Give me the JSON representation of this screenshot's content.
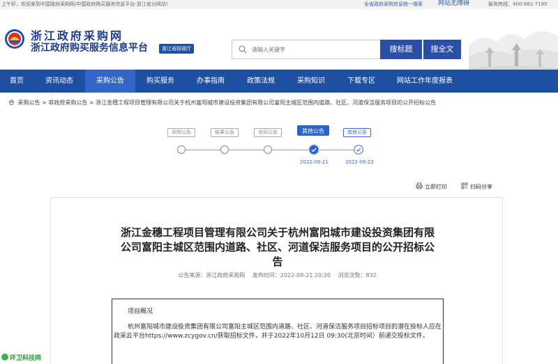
{
  "topbar": {
    "welcome": "上午好，欢迎来到中国政府采购网/中国政府购买服务信息平台-浙江省分网站！",
    "link_service": "全省政府采购信息统一搜索",
    "barrier_free": "网站无障碍",
    "phone": "服务热线：400-881-7190"
  },
  "header": {
    "brand_line1": "浙江政府采购网",
    "brand_line2": "浙江政府购买服务信息平台",
    "dept": "浙江省财政厅",
    "search_placeholder": "请输入关键字",
    "search_title_btn": "搜标题",
    "search_full_btn": "搜全文"
  },
  "nav": {
    "items": [
      {
        "label": "首页"
      },
      {
        "label": "资讯动态"
      },
      {
        "label": "采购公告"
      },
      {
        "label": "购买服务"
      },
      {
        "label": "办事指南"
      },
      {
        "label": "政策法规"
      },
      {
        "label": "采购知识"
      },
      {
        "label": "下载专区"
      },
      {
        "label": "网站工作年度报表"
      }
    ],
    "active_index": 2
  },
  "breadcrumb": "采购公告 > 非政府采购公告 > 浙江金穗工程项目管理有限公司关于杭州富阳城市建设投资集团有限公司富阳主城区范围内道路、社区、河道保洁服务项目的公开招标公告",
  "timeline": {
    "steps": [
      {
        "label": "采购公告",
        "state": "default",
        "date": ""
      },
      {
        "label": "结果公告",
        "state": "default",
        "date": ""
      },
      {
        "label": "合同公告",
        "state": "default",
        "date": ""
      },
      {
        "label": "其他公告",
        "state": "active",
        "date": "2022-09-21"
      },
      {
        "label": "其他公告",
        "state": "done",
        "date": "2022-09-22"
      }
    ]
  },
  "tools": {
    "print": "立即打印",
    "share": "扫码分享"
  },
  "article": {
    "title": "浙江金穗工程项目管理有限公司关于杭州富阳城市建设投资集团有限公司富阳主城区范围内道路、社区、河道保洁服务项目的公开招标公告",
    "source_label": "公告来源：",
    "source": "浙江政府采购网",
    "time_label": "发布时间：",
    "time": "2022-09-21 20:20",
    "views_label": "浏览次数：",
    "views": "832",
    "overview_heading": "项目概况",
    "overview_body": "杭州富阳城市建设投资集团有限公司富阳主城区范围内道路、社区、河道保洁服务项目招标项目的潜在投标人应在政采云平台https://www.zcygov.cn/获取招标文件，并于2022年10月12日 09:30(北京时间）前递交投标文件。"
  },
  "watermark": "环卫科技网",
  "colors": {
    "nav_bg": "#1f4fa0",
    "nav_active": "#3466c8",
    "brand": "#1d3c8c",
    "button": "#2a4fa8",
    "timeline_active": "#2a64c8"
  }
}
